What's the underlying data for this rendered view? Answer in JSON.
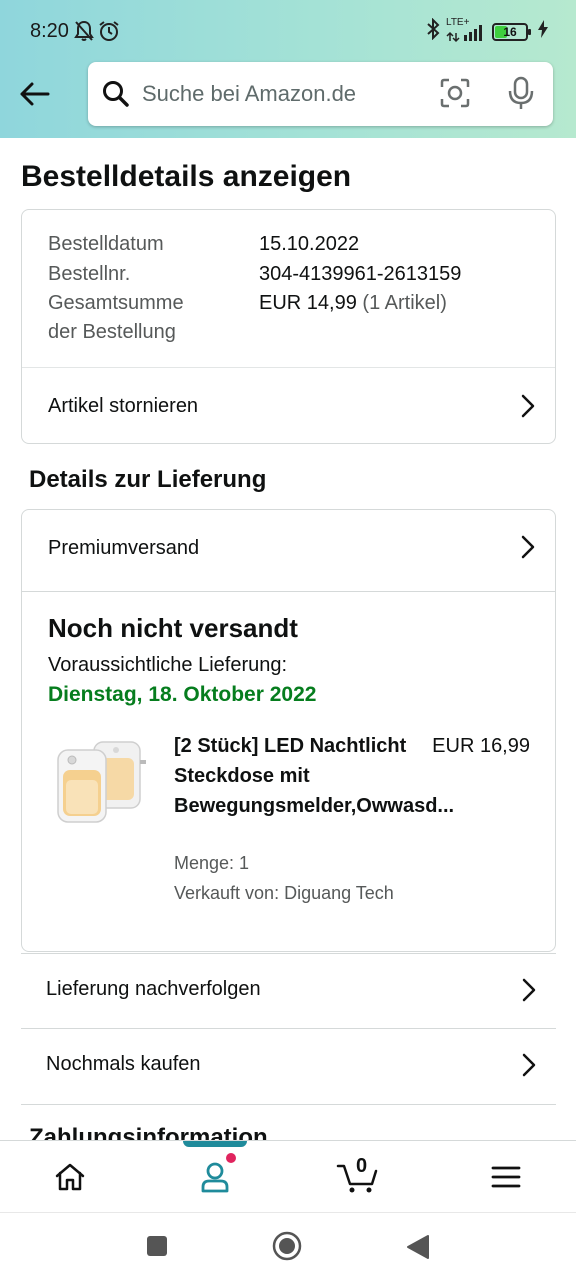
{
  "status_bar": {
    "time": "8:20",
    "network": "LTE+",
    "battery": "16"
  },
  "search": {
    "placeholder": "Suche bei Amazon.de"
  },
  "page": {
    "title": "Bestelldetails anzeigen"
  },
  "order_summary": {
    "date_label": "Bestelldatum",
    "date_value": "15.10.2022",
    "number_label": "Bestellnr.",
    "number_value": "304-4139961-2613159",
    "total_label_line1": "Gesamtsumme",
    "total_label_line2": "der Bestellung",
    "total_value": "EUR 14,99",
    "total_items": "(1 Artikel)",
    "cancel_label": "Artikel stornieren"
  },
  "delivery": {
    "section_title": "Details zur Lieferung",
    "shipping_method": "Premiumversand",
    "status_title": "Noch nicht versandt",
    "eta_label": "Voraussichtliche Lieferung:",
    "eta_date": "Dienstag, 18. Oktober 2022",
    "eta_color": "#067d1e",
    "product": {
      "title": "[2 Stück] LED Nachtlicht Steckdose mit Bewegungsmelder,Owwasd...",
      "price": "EUR 16,99",
      "quantity": "Menge: 1",
      "seller": "Verkauft von: Diguang Tech",
      "image_icon": "night-light-product-image"
    },
    "track_label": "Lieferung nachverfolgen",
    "buy_again_label": "Nochmals kaufen"
  },
  "payment": {
    "section_title": "Zahlungsinformation"
  },
  "bottom_nav": {
    "items": [
      "home-icon",
      "account-icon",
      "cart-icon",
      "menu-icon"
    ],
    "cart_count": "0",
    "active_color": "#1f8b9b",
    "notification_color": "#e0245e"
  },
  "system_nav": {
    "items": [
      "recents-square-icon",
      "home-circle-icon",
      "back-triangle-icon"
    ]
  }
}
